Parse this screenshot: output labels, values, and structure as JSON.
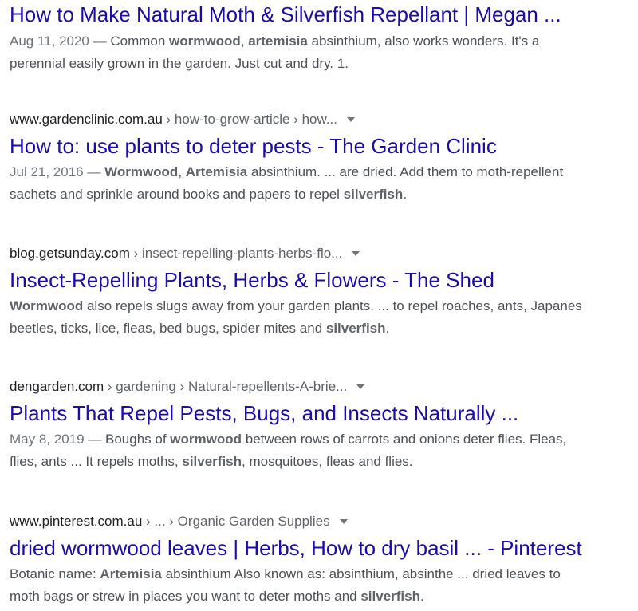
{
  "results": [
    {
      "title": "How to Make Natural Moth & Silverfish Repellant | Megan ...",
      "snippet": [
        [
          {
            "t": "Aug 11, 2020 — ",
            "c": "date"
          },
          {
            "t": "Common "
          },
          {
            "t": "wormwood",
            "b": true
          },
          {
            "t": ", "
          },
          {
            "t": "artemisia",
            "b": true
          },
          {
            "t": " absinthium, also works wonders. It's a"
          }
        ],
        [
          {
            "t": "perennial easily grown in the garden. Just cut and dry. 1."
          }
        ]
      ]
    },
    {
      "domain": "www.gardenclinic.com.au",
      "path": " › how-to-grow-article › how...",
      "title": "How to: use plants to deter pests - The Garden Clinic",
      "snippet": [
        [
          {
            "t": "Jul 21, 2016 — ",
            "c": "date"
          },
          {
            "t": "Wormwood",
            "b": true
          },
          {
            "t": ", "
          },
          {
            "t": "Artemisia",
            "b": true
          },
          {
            "t": " absinthium. ... are dried. Add them to moth-repellent"
          }
        ],
        [
          {
            "t": "sachets and sprinkle around books and papers to repel "
          },
          {
            "t": "silverfish",
            "b": true
          },
          {
            "t": "."
          }
        ]
      ]
    },
    {
      "domain": "blog.getsunday.com",
      "path": " › insect-repelling-plants-herbs-flo...",
      "title": "Insect-Repelling Plants, Herbs & Flowers - The Shed",
      "snippet": [
        [
          {
            "t": "Wormwood",
            "b": true
          },
          {
            "t": " also repels slugs away from your garden plants. ... to repel roaches, ants, Japanes"
          }
        ],
        [
          {
            "t": "beetles, ticks, lice, fleas, bed bugs, spider mites and "
          },
          {
            "t": "silverfish",
            "b": true
          },
          {
            "t": "."
          }
        ]
      ]
    },
    {
      "domain": "dengarden.com",
      "path": " › gardening › Natural-repellents-A-brie...",
      "title": "Plants That Repel Pests, Bugs, and Insects Naturally ...",
      "snippet": [
        [
          {
            "t": "May 8, 2019 — ",
            "c": "date"
          },
          {
            "t": "Boughs of "
          },
          {
            "t": "wormwood",
            "b": true
          },
          {
            "t": " between rows of carrots and onions deter flies. Fleas,"
          }
        ],
        [
          {
            "t": "flies, ants ... It repels moths, "
          },
          {
            "t": "silverfish",
            "b": true
          },
          {
            "t": ", mosquitoes, fleas and flies."
          }
        ]
      ]
    },
    {
      "domain": "www.pinterest.com.au",
      "path": " › ... › Organic Garden Supplies",
      "title": "dried wormwood leaves | Herbs, How to dry basil ... - Pinterest",
      "snippet": [
        [
          {
            "t": "Botanic name: "
          },
          {
            "t": "Artemisia",
            "b": true
          },
          {
            "t": " absinthium Also known as: absinthium, absinthe ... dried leaves to"
          }
        ],
        [
          {
            "t": "moth bags or strew in places you want to deter moths and "
          },
          {
            "t": "silverfish",
            "b": true
          },
          {
            "t": "."
          }
        ]
      ]
    }
  ],
  "colors": {
    "link": "#1a0dab",
    "snippet": "#4d5156",
    "date": "#70757a",
    "crumb": "#202124"
  }
}
